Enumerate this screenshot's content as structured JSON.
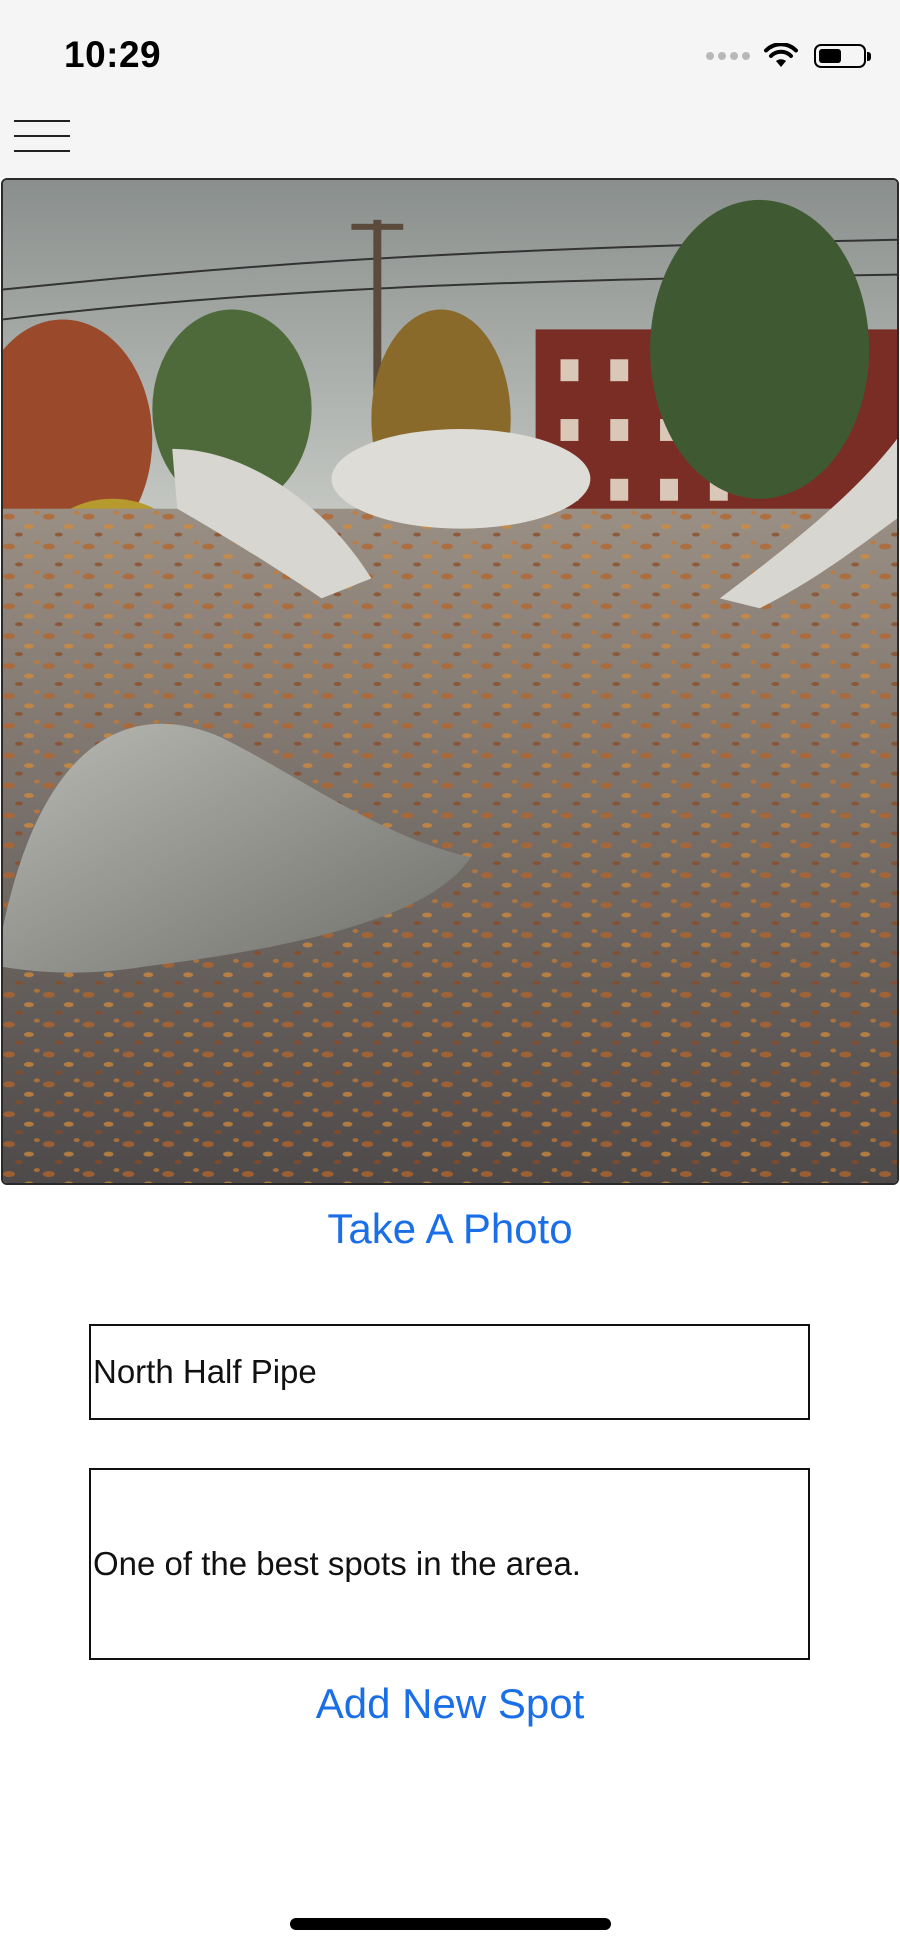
{
  "status_bar": {
    "time": "10:29"
  },
  "icons": {
    "menu": "hamburger-menu-icon",
    "wifi": "wifi-icon",
    "battery": "battery-icon",
    "signal": "cellular-signal-icon"
  },
  "photo": {
    "description": "Skatepark photo with autumn leaves"
  },
  "take_photo_label": "Take A Photo",
  "form": {
    "name_value": "North Half Pipe",
    "description_value": "One of the best spots in the area."
  },
  "add_spot_label": "Add New Spot",
  "colors": {
    "accent": "#1a6ee8",
    "topbar": "#f5f5f5"
  }
}
